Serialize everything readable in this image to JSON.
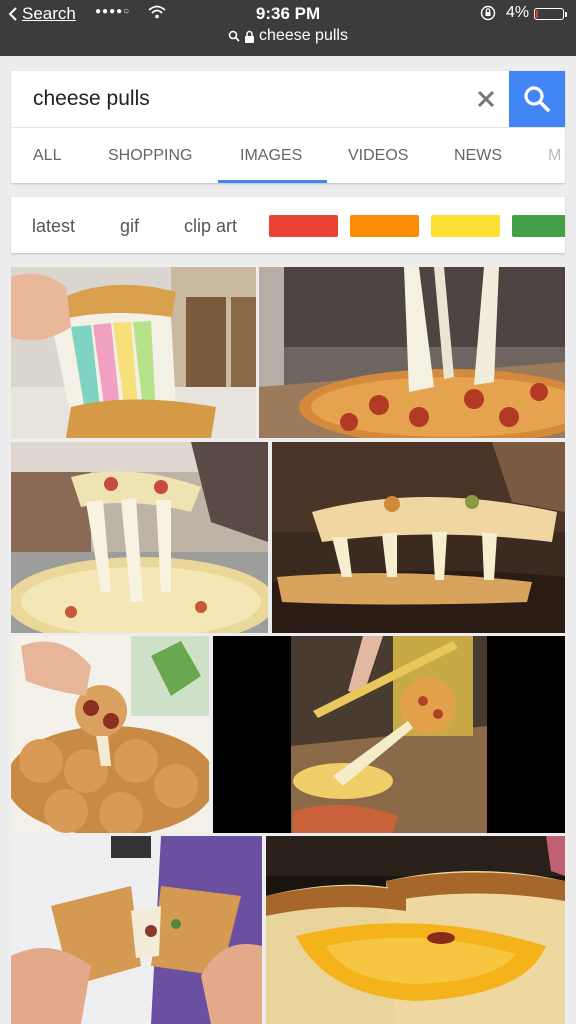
{
  "status_bar": {
    "back_label": "Search",
    "time": "9:36 PM",
    "battery_percent": "4%",
    "battery_level": 0.04,
    "url": "cheese pulls"
  },
  "search": {
    "query": "cheese pulls",
    "clear_icon": "close-icon",
    "search_icon": "search-icon",
    "accent_color": "#4285f4"
  },
  "tabs": [
    {
      "label": "ALL",
      "active": false
    },
    {
      "label": "SHOPPING",
      "active": false
    },
    {
      "label": "IMAGES",
      "active": true
    },
    {
      "label": "VIDEOS",
      "active": false
    },
    {
      "label": "NEWS",
      "active": false
    },
    {
      "label": "M",
      "active": false
    }
  ],
  "chips": {
    "text": [
      "latest",
      "gif",
      "clip art"
    ],
    "colors": [
      "#ea4335",
      "#fb8c00",
      "#fbe134",
      "#43a047"
    ]
  },
  "results": [
    {
      "icon": "rainbow-grilled-cheese-image"
    },
    {
      "icon": "pepperoni-pizza-cheese-pull-image"
    },
    {
      "icon": "pizza-slice-lift-image"
    },
    {
      "icon": "pizza-slice-closeup-image"
    },
    {
      "icon": "pepperoni-pull-apart-bread-image"
    },
    {
      "icon": "pizza-cheese-stretch-dark-image"
    },
    {
      "icon": "quesadilla-pull-image"
    },
    {
      "icon": "grilled-cheese-closeup-image"
    }
  ]
}
